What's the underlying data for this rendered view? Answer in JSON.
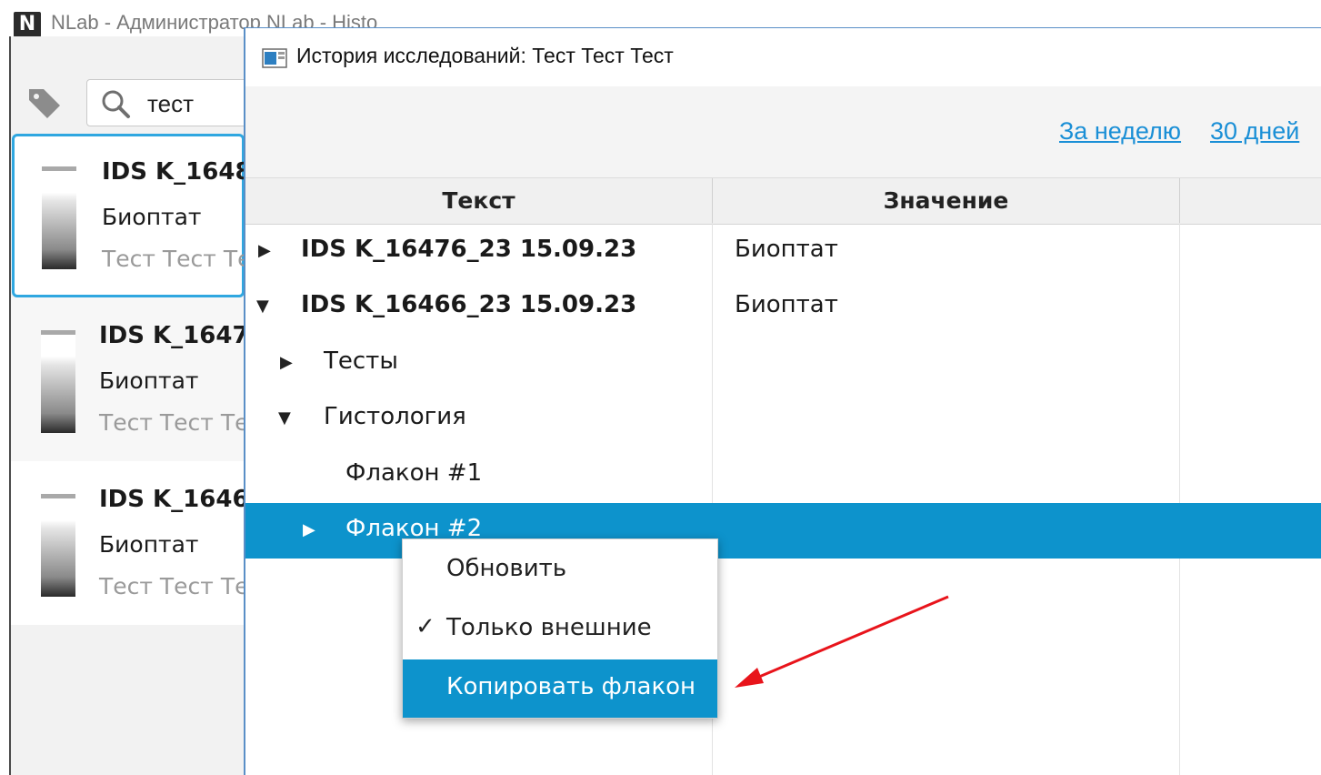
{
  "main_window": {
    "logo": "N",
    "title": "NLab - Администратор NLab - Histo",
    "search": {
      "value": "тест"
    },
    "samples": [
      {
        "id": "IDS K_1648",
        "type": "Биоптат",
        "patient": "Тест Тест Те"
      },
      {
        "id": "IDS K_1647",
        "type": "Биоптат",
        "patient": "Тест Тест Те"
      },
      {
        "id": "IDS K_1646",
        "type": "Биоптат",
        "patient": "Тест Тест Те"
      }
    ]
  },
  "dialog": {
    "title": "История исследований: Тест Тест Тест",
    "links": [
      "За неделю",
      "30 дней"
    ],
    "columns": [
      "Текст",
      "Значение"
    ],
    "rows": [
      {
        "arrow": "▶",
        "text": "IDS K_16476_23 15.09.23",
        "value": "Биоптат"
      },
      {
        "arrow": "▼",
        "text": "IDS K_16466_23 15.09.23",
        "value": "Биоптат"
      },
      {
        "arrow": "▶",
        "text": "Тесты",
        "value": ""
      },
      {
        "arrow": "▼",
        "text": "Гистология",
        "value": ""
      },
      {
        "arrow": "",
        "text": "Флакон #1",
        "value": ""
      },
      {
        "arrow": "▶",
        "text": "Флакон #2",
        "value": ""
      }
    ],
    "selected_row": 5
  },
  "context_menu": {
    "items": [
      {
        "label": "Обновить",
        "checked": false
      },
      {
        "label": "Только внешние",
        "checked": true,
        "check_mark": "✓"
      },
      {
        "label": "Копировать флакон",
        "checked": false
      }
    ],
    "highlighted_index": 2
  },
  "colors": {
    "selection": "#0d93cc",
    "link": "#1a8fd6",
    "annotation_arrow": "#e8141b",
    "card_focus_border": "#2fa7e0"
  }
}
